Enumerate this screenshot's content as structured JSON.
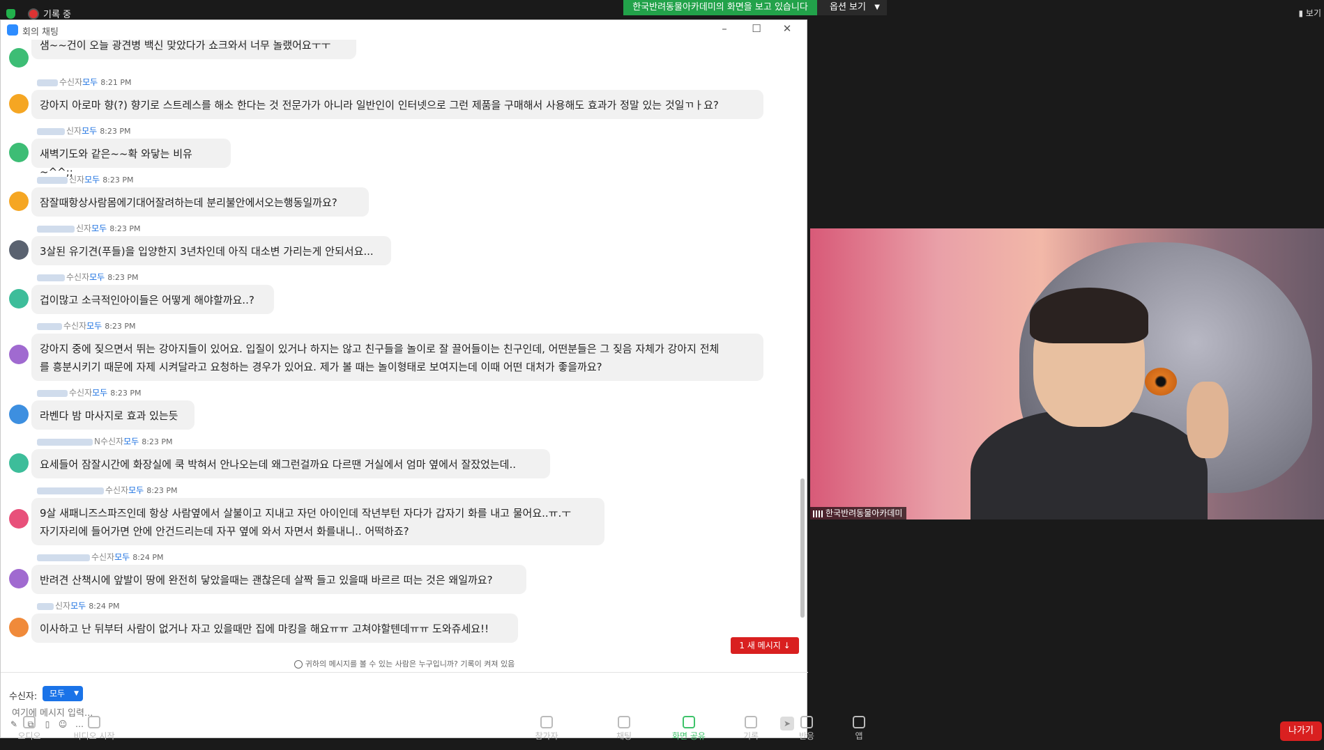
{
  "top_strip": {
    "recording_label": "기록 중",
    "share_banner": "한국반려동물아카데미의 화면을 보고 있습니다",
    "options_label": "옵션 보기",
    "view_label": "보기"
  },
  "chat": {
    "window_title": "회의 채팅",
    "recipient_tail": "수신자",
    "recipient_all": "모두",
    "messages": [
      {
        "sender_tail": "",
        "time": "",
        "text": "샘~~건이 오늘 광견병 백신 맞았다가 쇼크와서  너무 놀랬어요ㅜㅜ",
        "avatar_color": "#3dbd75"
      },
      {
        "sender_tail": "수신자",
        "time": "8:21 PM",
        "text": "강아지 아로마 향(?) 향기로 스트레스를 해소 한다는 것 전문가가 아니라 일반인이 인터넷으로 그런 제품을 구매해서 사용해도 효과가 정말 있는 것일ㄲㅏ요?",
        "avatar_color": "#f5a623"
      },
      {
        "sender_tail": "신자",
        "time": "8:23 PM",
        "text": "새벽기도와 같은~~확 와닿는 비유~^^;;",
        "avatar_color": "#3dbd75"
      },
      {
        "sender_tail": "신자",
        "time": "8:23 PM",
        "text": "잠잘때항상사람몸에기대어잘려하는데 분리불안에서오는행동일까요?",
        "avatar_color": "#f5a623"
      },
      {
        "sender_tail": "신자",
        "time": "8:23 PM",
        "text": "3살된 유기견(푸들)을 입양한지 3년차인데 아직 대소변 가리는게 안되서요...",
        "avatar_color": "#5a6270"
      },
      {
        "sender_tail": "수신자",
        "time": "8:23 PM",
        "text": "겁이많고 소극적인아이들은 어떻게 해야할까요..?",
        "avatar_color": "#3dbd9a"
      },
      {
        "sender_tail": "수신자",
        "time": "8:23 PM",
        "text": "강아지 중에 짖으면서 뛰는 강아지들이 있어요. 입질이 있거나 하지는 않고 친구들을 놀이로 잘 끌어들이는 친구인데, 어떤분들은 그 짖음 자체가 강아지 전체\n를 흥분시키기 때문에 자제 시켜달라고 요청하는 경우가 있어요. 제가 볼 때는 놀이형태로 보여지는데 이때 어떤 대처가 좋을까요?",
        "avatar_color": "#a06ad0"
      },
      {
        "sender_tail": "수신자",
        "time": "8:23 PM",
        "text": "라벤다 밤 마사지로 효과 있는듯",
        "avatar_color": "#3d8fe0"
      },
      {
        "sender_tail": "N수신자",
        "time": "8:23 PM",
        "text": "요세들어 잠잘시간에 화장실에 쿡 박혀서 안나오는데 왜그런걸까요 다르땐 거실에서 엄마 옆에서 잘잤었는데..",
        "avatar_color": "#3dbd9a"
      },
      {
        "sender_tail": "수신자",
        "time": "8:23 PM",
        "text": "9살 새패니즈스파즈인데 항상 사람옆에서 살불이고 지내고 자던 아이인데 작년부턴 자다가 갑자기 화를 내고 물어요..ㅠ.ㅜ\n자기자리에 들어가면 안에 안건드리는데 자꾸 옆에 와서 자면서 화를내니.. 어떡하죠?",
        "avatar_color": "#e8507a"
      },
      {
        "sender_tail": "수신자",
        "time": "8:24 PM",
        "text": "반려견 산책시에 앞발이 땅에 완전히 닿았을때는 괜찮은데 살짝 들고 있을때 바르르 떠는 것은 왜일까요?",
        "avatar_color": "#a06ad0"
      },
      {
        "sender_tail": "신자",
        "time": "8:24 PM",
        "text": "이사하고 난 뒤부터 사람이 없거나 자고 있을때만 집에 마킹을 해요ㅠㅠ 고쳐야할텐데ㅠㅠ 도와쥬세요!!",
        "avatar_color": "#f08a3a"
      }
    ],
    "new_message_button": "1 새 메시지",
    "privacy_notice": "귀하의 메시지를 볼 수 있는 사람은 누구입니까? 기록이 켜져 있음",
    "to_label": "수신자:",
    "to_value": "모두",
    "input_placeholder": "여기에 메시지 입력..."
  },
  "video": {
    "participant_name": "한국반려동물아카데미"
  },
  "zoom_toolbar": {
    "items": [
      "오디오",
      "비디오 시작",
      "참가자",
      "채팅",
      "화면 공유",
      "기록",
      "반응",
      "앱"
    ],
    "leave_label": "나가기"
  }
}
